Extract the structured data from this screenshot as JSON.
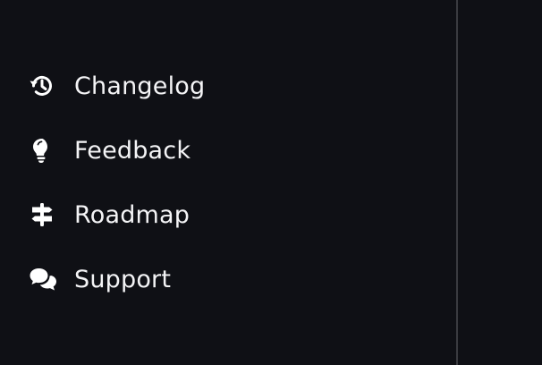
{
  "colors": {
    "background": "#0f1015",
    "divider": "#3a3b40",
    "text": "#f4f4f6",
    "icon": "#ffffff"
  },
  "sidebar": {
    "items": [
      {
        "label": "Changelog",
        "icon": "history-icon"
      },
      {
        "label": "Feedback",
        "icon": "lightbulb-icon"
      },
      {
        "label": "Roadmap",
        "icon": "signpost-icon"
      },
      {
        "label": "Support",
        "icon": "chat-bubbles-icon"
      }
    ]
  }
}
